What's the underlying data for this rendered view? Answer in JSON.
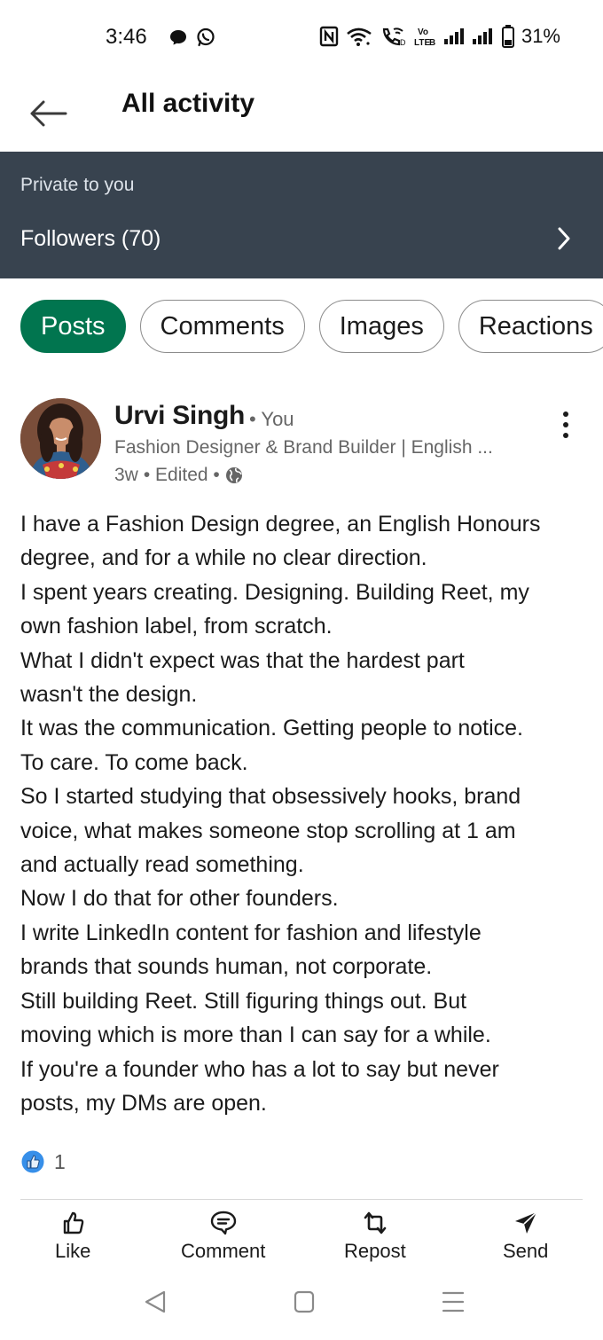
{
  "status_bar": {
    "time": "3:46",
    "battery": "31%",
    "left_icons": [
      "chat-bubble-icon",
      "whatsapp-icon"
    ],
    "right_icons": [
      "nfc-icon",
      "wifi-icon",
      "wifi-call-icon",
      "volte-icon",
      "signal-icon",
      "signal-icon",
      "battery-icon"
    ],
    "volte_text_top": "Vo",
    "volte_text_bottom": "LTE",
    "volte_sim": "B"
  },
  "header": {
    "title": "All activity",
    "back_icon": "arrow-left-icon"
  },
  "banner": {
    "label": "Private to you",
    "followers": "Followers (70)",
    "chevron_icon": "chevron-right-icon",
    "background": "#38434f"
  },
  "filters": {
    "items": [
      "Posts",
      "Comments",
      "Images",
      "Reactions"
    ],
    "active": "Posts",
    "active_color": "#01754f"
  },
  "post": {
    "author": "Urvi Singh",
    "you_label": "• You",
    "headline": "Fashion Designer & Brand Builder | English ...",
    "age": "3w",
    "edited": "• Edited •",
    "visibility_icon": "globe-icon",
    "body_lines": [
      "I have a Fashion Design degree, an English Honours",
      "degree, and for a while  no clear direction.",
      "I spent years creating. Designing. Building Reet, my",
      "own fashion label, from scratch.",
      "What I didn't expect was that the hardest part",
      "wasn't the design.",
      "It was the communication. Getting people to notice.",
      "To care. To come back.",
      "So I started studying that obsessively hooks, brand",
      "voice, what makes someone stop scrolling at 1 am",
      "and actually read something.",
      "Now I do that for other founders.",
      "I write LinkedIn content for fashion and lifestyle",
      "brands that sounds human, not corporate.",
      "Still building Reet. Still figuring things out. But",
      "moving which is more than I can say for a while.",
      "If you're a founder who has a lot to say but never",
      "posts, my DMs are open."
    ],
    "reaction_count": "1",
    "reaction_icon": "like-reaction-icon",
    "actions": [
      {
        "label": "Like",
        "icon": "thumbs-up-icon"
      },
      {
        "label": "Comment",
        "icon": "comment-icon"
      },
      {
        "label": "Repost",
        "icon": "repost-icon"
      },
      {
        "label": "Send",
        "icon": "send-icon"
      }
    ]
  },
  "nav_bar": {
    "icons": [
      "nav-back-icon",
      "nav-home-icon",
      "nav-menu-icon"
    ]
  }
}
